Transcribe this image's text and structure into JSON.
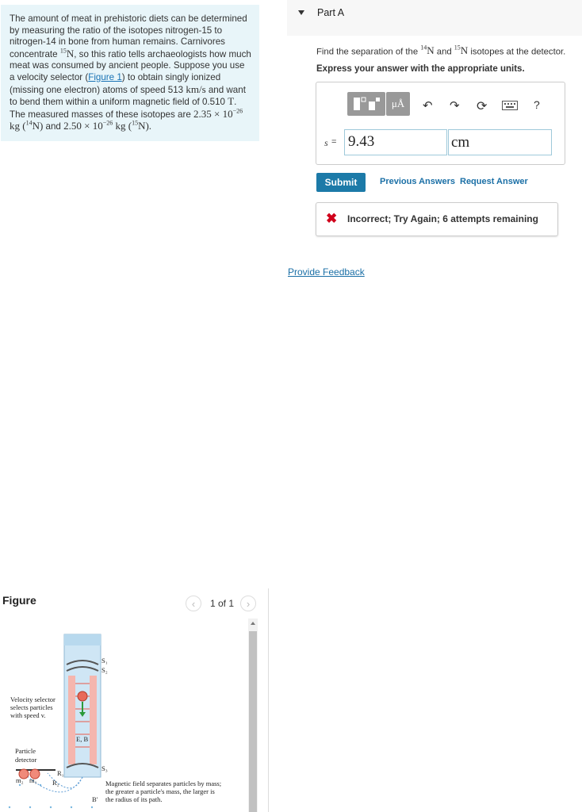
{
  "problem": {
    "text1": "The amount of meat in prehistoric diets can be determined by measuring the ratio of the isotopes nitrogen-15 to nitrogen-14 in bone from human remains. Carnivores concentrate ",
    "n15_sup": "15",
    "n15_sym": "N",
    "text2": ", so this ratio tells archaeologists how much meat was consumed by ancient people. Suppose you use a velocity selector (",
    "figure_link": "Figure 1",
    "text3": ") to obtain singly ionized (missing one electron) atoms of speed 513 ",
    "speed_unit": "km/s",
    "text4": " and want to bend them within a uniform magnetic field of 0.510 ",
    "field_unit": "T",
    "text5": ". The measured masses of these isotopes are",
    "mass1": "2.35 × 10",
    "exp1": "−26",
    "kg1": " kg (",
    "iso1_sup": "14",
    "iso1_sym": "N)",
    "and": " and ",
    "mass2": "2.50 × 10",
    "exp2": "−26",
    "kg2": " kg (",
    "iso2_sup": "15",
    "iso2_sym": "N)."
  },
  "figure": {
    "title": "Figure",
    "pager": "1 of 1",
    "prev_icon": "chevron-left-icon",
    "next_icon": "chevron-right-icon",
    "labels": {
      "velocity_selector": [
        "Velocity selector",
        "selects particles",
        "with speed v."
      ],
      "particle_detector": [
        "Particle",
        "detector"
      ],
      "magnetic_note": [
        "Magnetic field separates particles by mass;",
        "the greater a particle's mass, the larger is",
        "the radius of its path."
      ],
      "s1": "S₁",
      "s2": "S₂",
      "s3": "S₃",
      "eb": "E, B",
      "m2": "m₂",
      "m1": "m₁",
      "r1": "R₁",
      "r2": "R₂",
      "bprime": "B′"
    }
  },
  "partA": {
    "title": "Part A",
    "question_pre": "Find the separation of the ",
    "q_sup1": "14",
    "q_sym1": "N",
    "q_mid": " and ",
    "q_sup2": "15",
    "q_sym2": "N",
    "question_post": " isotopes at the detector.",
    "instruction": "Express your answer with the appropriate units.",
    "toolbar": {
      "units_label": "μÅ",
      "undo_icon": "undo-icon",
      "redo_icon": "redo-icon",
      "reset_icon": "reset-icon",
      "keyboard_icon": "keyboard-icon",
      "help_label": "?"
    },
    "variable": "s",
    "equals": "=",
    "value": "9.43",
    "unit": "cm",
    "submit": "Submit",
    "previous_answers": "Previous Answers",
    "request_answer": "Request Answer",
    "feedback": "Incorrect; Try Again; 6 attempts remaining"
  },
  "provide_feedback": "Provide Feedback",
  "colors": {
    "problem_bg": "#e8f5f9",
    "link": "#1a6fa6",
    "submit_bg": "#1c7aa8",
    "error": "#d0021b"
  }
}
